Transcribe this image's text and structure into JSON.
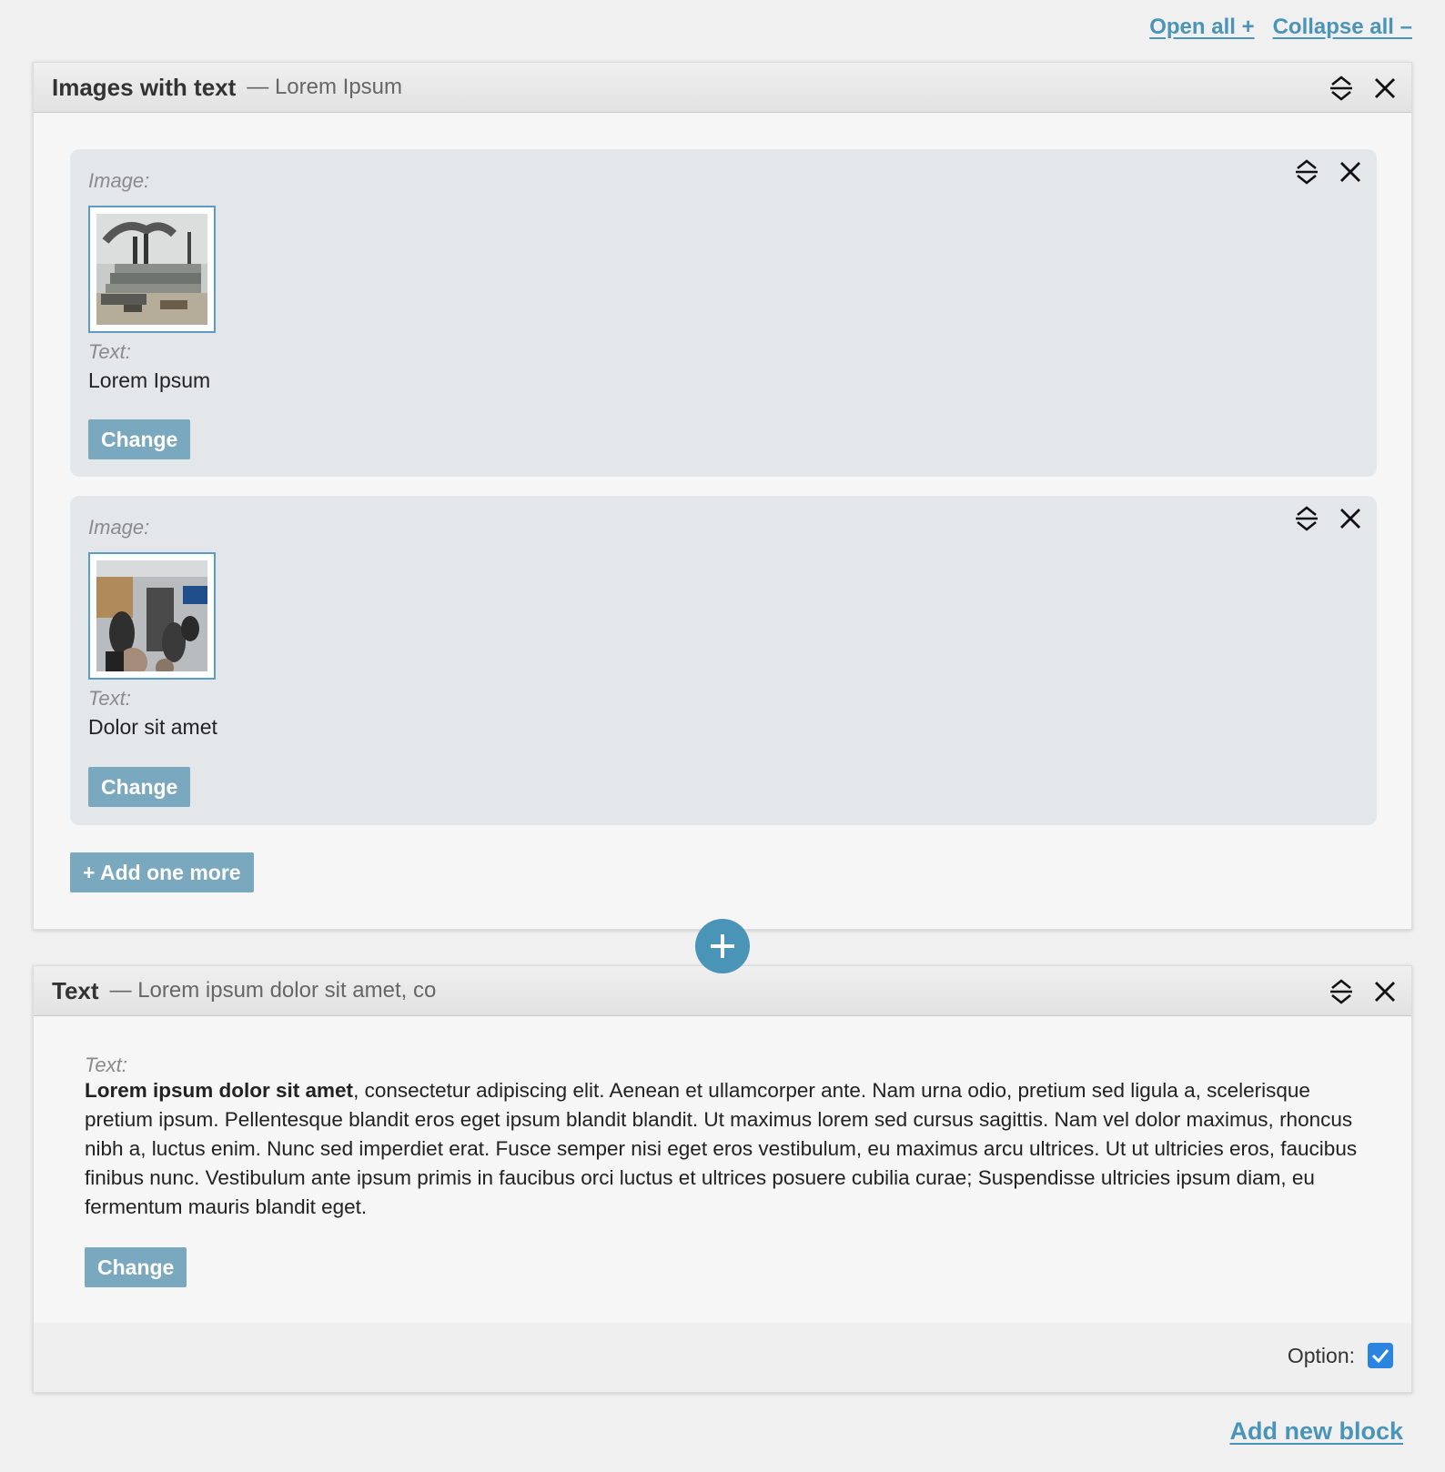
{
  "top_links": {
    "open_all": "Open all +",
    "collapse_all": "Collapse all –"
  },
  "block1": {
    "title": "Images with text",
    "subtitle": "— Lorem Ipsum",
    "items": [
      {
        "image_label": "Image:",
        "text_label": "Text:",
        "text_value": "Lorem Ipsum",
        "change_label": "Change"
      },
      {
        "image_label": "Image:",
        "text_label": "Text:",
        "text_value": "Dolor sit amet",
        "change_label": "Change"
      }
    ],
    "add_more_label": "+ Add one more"
  },
  "block2": {
    "title": "Text",
    "subtitle": "— Lorem ipsum dolor sit amet, co",
    "text_label": "Text:",
    "text_bold": "Lorem ipsum dolor sit amet",
    "text_rest": ", consectetur adipiscing elit. Aenean et ullamcorper ante. Nam urna odio, pretium sed ligula a, scelerisque pretium ipsum. Pellentesque blandit eros eget ipsum blandit blandit. Ut maximus lorem sed cursus sagittis. Nam vel dolor maximus, rhoncus nibh a, luctus enim. Nunc sed imperdiet erat. Fusce semper nisi eget eros vestibulum, eu maximus arcu ultrices. Ut ut ultricies eros, faucibus finibus nunc. Vestibulum ante ipsum primis in faucibus orci luctus et ultrices posuere cubilia curae; Suspendisse ultricies ipsum diam, eu fermentum mauris blandit eget.",
    "change_label": "Change",
    "option_label": "Option:",
    "option_checked": true
  },
  "add_new_block": "Add new block",
  "colors": {
    "accent": "#4a94b8",
    "button": "#7aa8be",
    "checkbox": "#2b84e0",
    "card": "#e3e7ea"
  },
  "icons": {
    "reorder": "collapse-arrows-icon",
    "close": "close-icon",
    "add": "plus-icon",
    "check": "checkmark-icon"
  }
}
